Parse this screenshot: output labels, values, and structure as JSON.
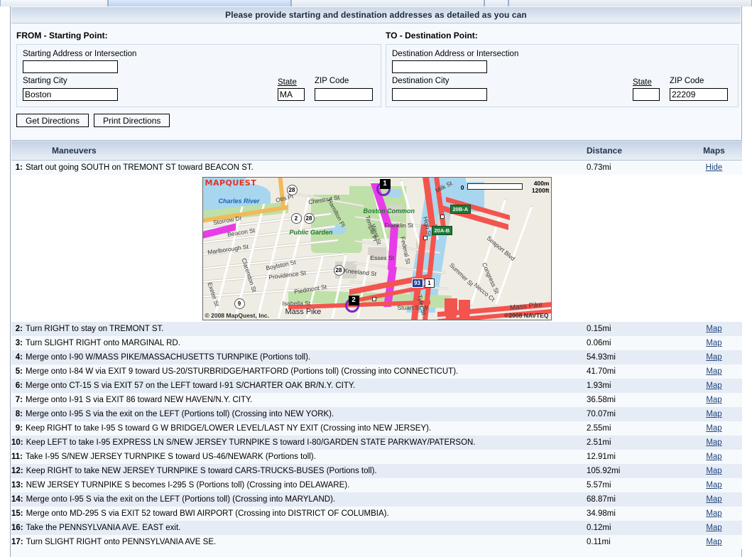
{
  "banner": {
    "title": "Please provide starting and destination addresses as detailed as you can"
  },
  "form": {
    "from": {
      "heading": "FROM - Starting Point:",
      "address_label": "Starting Address or Intersection",
      "address_value": "",
      "city_label": "Starting City",
      "city_value": "Boston",
      "state_label": "State",
      "state_value": "MA",
      "zip_label": "ZIP Code",
      "zip_value": ""
    },
    "to": {
      "heading": "TO - Destination Point:",
      "address_label": "Destination Address or Intersection",
      "address_value": "",
      "city_label": "Destination City",
      "city_value": "",
      "state_label": "State",
      "state_value": "",
      "zip_label": "ZIP Code",
      "zip_value": "22209"
    },
    "buttons": {
      "get_directions": "Get Directions",
      "print_directions": "Print Directions"
    }
  },
  "table": {
    "headers": {
      "maneuvers": "Maneuvers",
      "distance": "Distance",
      "maps": "Maps"
    },
    "map_link_label": "Map",
    "hide_link_label": "Hide",
    "rows": [
      {
        "num": "1:",
        "text": "Start out going SOUTH on TREMONT ST toward BEACON ST.",
        "distance": "0.73mi",
        "link": "Hide"
      },
      {
        "num": "2:",
        "text": "Turn RIGHT to stay on TREMONT ST.",
        "distance": "0.15mi",
        "link": "Map"
      },
      {
        "num": "3:",
        "text": "Turn SLIGHT RIGHT onto MARGINAL RD.",
        "distance": "0.06mi",
        "link": "Map"
      },
      {
        "num": "4:",
        "text": "Merge onto I-90 W/MASS PIKE/MASSACHUSETTS TURNPIKE (Portions toll).",
        "distance": "54.93mi",
        "link": "Map"
      },
      {
        "num": "5:",
        "text": "Merge onto I-84 W via EXIT 9 toward US-20/STURBRIDGE/HARTFORD (Portions toll) (Crossing into CONNECTICUT).",
        "distance": "41.70mi",
        "link": "Map"
      },
      {
        "num": "6:",
        "text": "Merge onto CT-15 S via EXIT 57 on the LEFT toward I-91 S/CHARTER OAK BR/N.Y. CITY.",
        "distance": "1.93mi",
        "link": "Map"
      },
      {
        "num": "7:",
        "text": "Merge onto I-91 S via EXIT 86 toward NEW HAVEN/N.Y. CITY.",
        "distance": "36.58mi",
        "link": "Map"
      },
      {
        "num": "8:",
        "text": "Merge onto I-95 S via the exit on the LEFT (Portions toll) (Crossing into NEW YORK).",
        "distance": "70.07mi",
        "link": "Map"
      },
      {
        "num": "9:",
        "text": "Keep RIGHT to take I-95 S toward G W BRIDGE/LOWER LEVEL/LAST NY EXIT (Crossing into NEW JERSEY).",
        "distance": "2.55mi",
        "link": "Map"
      },
      {
        "num": "10:",
        "text": "Keep LEFT to take I-95 EXPRESS LN S/NEW JERSEY TURNPIKE S toward I-80/GARDEN STATE PARKWAY/PATERSON.",
        "distance": "2.51mi",
        "link": "Map"
      },
      {
        "num": "11:",
        "text": "Take I-95 S/NEW JERSEY TURNPIKE S toward US-46/NEWARK (Portions toll).",
        "distance": "12.91mi",
        "link": "Map"
      },
      {
        "num": "12:",
        "text": "Keep RIGHT to take NEW JERSEY TURNPIKE S toward CARS-TRUCKS-BUSES (Portions toll).",
        "distance": "105.92mi",
        "link": "Map"
      },
      {
        "num": "13:",
        "text": "NEW JERSEY TURNPIKE S becomes I-295 S (Portions toll) (Crossing into DELAWARE).",
        "distance": "5.57mi",
        "link": "Map"
      },
      {
        "num": "14:",
        "text": "Merge onto I-95 S via the exit on the LEFT (Portions toll) (Crossing into MARYLAND).",
        "distance": "68.87mi",
        "link": "Map"
      },
      {
        "num": "15:",
        "text": "Merge onto MD-295 S via EXIT 52 toward BWI AIRPORT (Crossing into DISTRICT OF COLUMBIA).",
        "distance": "34.98mi",
        "link": "Map"
      },
      {
        "num": "16:",
        "text": "Take the PENNSYLVANIA AVE. EAST exit.",
        "distance": "0.12mi",
        "link": "Map"
      },
      {
        "num": "17:",
        "text": "Turn SLIGHT RIGHT onto PENNSYLVANIA AVE SE.",
        "distance": "0.11mi",
        "link": "Map"
      }
    ]
  },
  "map": {
    "logo": "MAPQUEST",
    "copyright_left": "© 2008 MapQuest, Inc.",
    "copyright_right": "©2008 NAVTEQ",
    "scale_zero": "0",
    "scale_metric": "400m",
    "scale_imperial": "1200ft",
    "city_label": "Boston",
    "marker_start": "1",
    "marker_end": "2",
    "water_labels": [
      "Charles River"
    ],
    "park_labels": [
      "Public Garden",
      "Boston Common"
    ],
    "street_labels": [
      "Storrow Dr",
      "Beacon St",
      "Marlborough St",
      "Clarendon St",
      "Exeter St",
      "Boylston St",
      "Providence St",
      "Piedmont St",
      "Isabella St",
      "Mass Pike",
      "Otis Pl",
      "Chestnut St",
      "Hamilton Pl",
      "Temple Pl",
      "West St",
      "Franklin St",
      "Essex St",
      "Kneeland St",
      "Federal St",
      "High St",
      "Milk St",
      "Summer St",
      "Congress St",
      "Necco Ct",
      "Seaport Blvd",
      "Tyler St",
      "Stuart St W",
      "Mass Pike"
    ],
    "route_shields": [
      "28",
      "2",
      "28",
      "28",
      "9"
    ],
    "exit_badges": [
      "20B-A",
      "20A-B"
    ],
    "highway_shields": [
      "93",
      "1"
    ]
  }
}
